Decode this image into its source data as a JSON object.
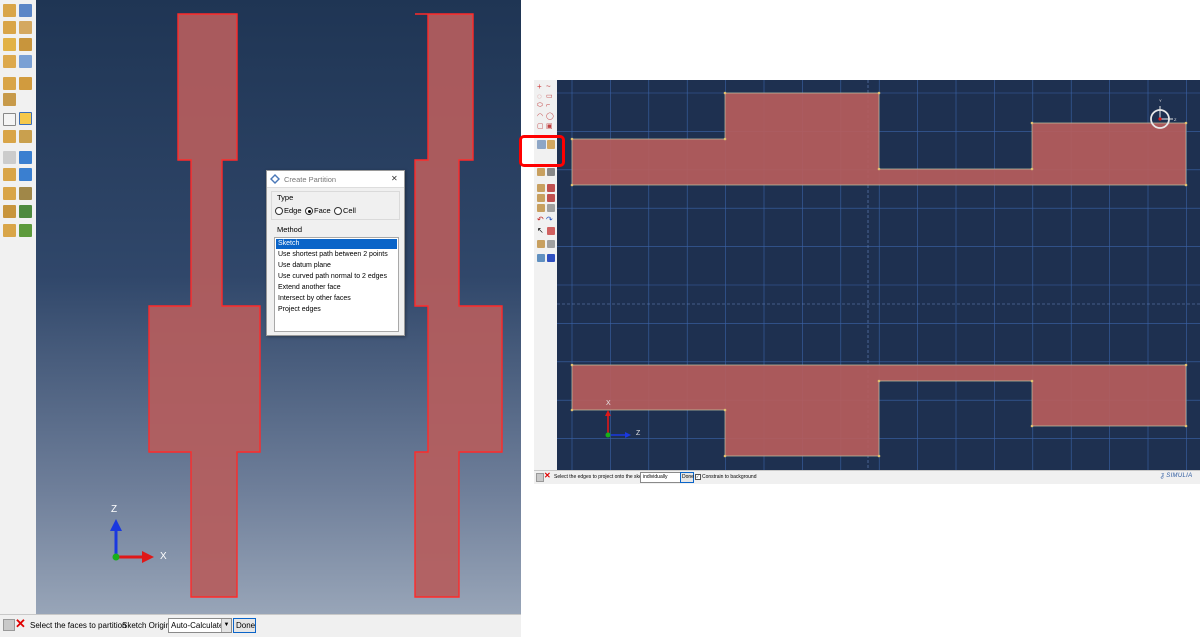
{
  "left": {
    "dialog": {
      "title": "Create Partition",
      "close_glyph": "✕",
      "type_label": "Type",
      "type_options": [
        {
          "label": "Edge",
          "selected": false
        },
        {
          "label": "Face",
          "selected": true
        },
        {
          "label": "Cell",
          "selected": false
        }
      ],
      "method_label": "Method",
      "methods": [
        {
          "label": "Sketch",
          "selected": true
        },
        {
          "label": "Use shortest path between 2 points",
          "selected": false
        },
        {
          "label": "Use datum plane",
          "selected": false
        },
        {
          "label": "Use curved path normal to 2 edges",
          "selected": false
        },
        {
          "label": "Extend another face",
          "selected": false
        },
        {
          "label": "Intersect by other faces",
          "selected": false
        },
        {
          "label": "Project edges",
          "selected": false
        }
      ]
    },
    "triad": {
      "z_label": "Z",
      "x_label": "X"
    },
    "status": {
      "prompt": "Select the faces to partition",
      "origin_label": "Sketch Origin:",
      "origin_value": "Auto-Calculate",
      "done_label": "Done"
    }
  },
  "right": {
    "triad": {
      "x_label": "X",
      "z_label": "Z"
    },
    "view_triad": {
      "y_label": "Y",
      "z_label": "Z"
    },
    "status": {
      "prompt": "Select the edges to project onto the sketch",
      "mode_value": "individually",
      "done_label": "Done",
      "checkbox_label": "Constrain to background",
      "checkbox_checked": true
    },
    "brand": "SIMULIA"
  },
  "colors": {
    "part_fill": "#b55d5d",
    "part_edge": "#ff2a2a",
    "dialog_selection": "#0a64c8",
    "axis_x": "#1a38e0",
    "axis_y": "#18b018",
    "axis_z": "#e01818"
  }
}
